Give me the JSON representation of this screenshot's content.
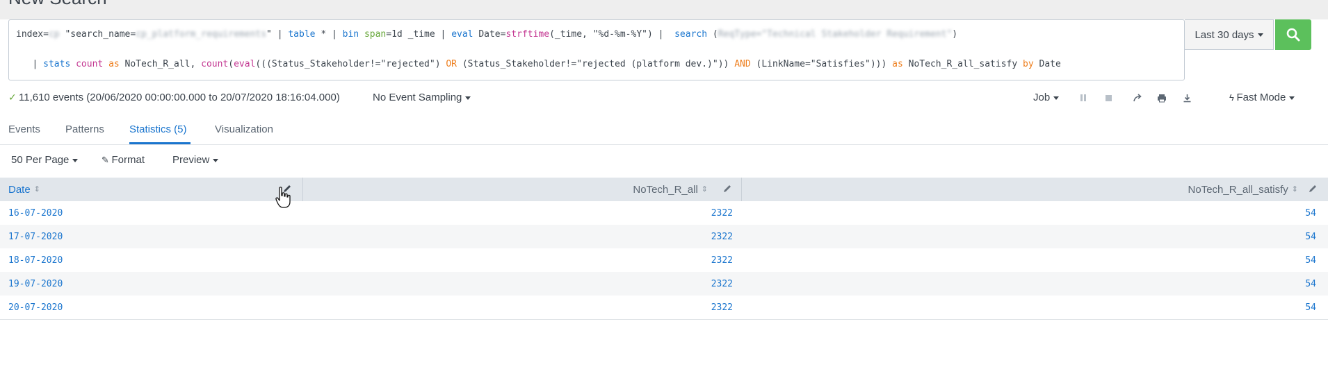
{
  "header": {
    "title": "New Search"
  },
  "search": {
    "line1": {
      "p1": "index=",
      "p1_blur": "cp",
      "p2": " \"search_name=",
      "p2_blur": "cp_platform_requirements",
      "p3": "\" | ",
      "table": "table",
      "p4": " * | ",
      "bin": "bin",
      "p5": " ",
      "span": "span",
      "p6": "=1d _time | ",
      "eval": "eval",
      "p7": " Date=",
      "strftime": "strftime",
      "p8": "(_time, \"%d-%m-%Y\") |  ",
      "search_kw": "search",
      "p9": " (",
      "p9_blur": "ReqType=\"Technical Stakeholder Requirement\"",
      "p10": ")"
    },
    "line2": {
      "p1": "   | ",
      "stats": "stats",
      "p2": " ",
      "count": "count",
      "p3": " ",
      "as1": "as",
      "p4": " NoTech_R_all, ",
      "count2": "count",
      "p5": "(",
      "eval2": "eval",
      "p6": "(((Status_Stakeholder!=\"rejected\") ",
      "or": "OR",
      "p7": " (Status_Stakeholder!=\"rejected (platform dev.)\")) ",
      "and": "AND",
      "p8": " (LinkName=\"Satisfies\"))) ",
      "as2": "as",
      "p9": " NoTech_R_all_satisfy ",
      "by": "by",
      "p10": " Date"
    }
  },
  "time_range": {
    "label": "Last 30 days"
  },
  "status": {
    "events": "11,610 events (20/06/2020 00:00:00.000 to 20/07/2020 18:16:04.000)",
    "sampling": "No Event Sampling",
    "job": "Job",
    "mode": "Fast Mode"
  },
  "tabs": [
    {
      "label": "Events"
    },
    {
      "label": "Patterns"
    },
    {
      "label": "Statistics (5)"
    },
    {
      "label": "Visualization"
    }
  ],
  "toolbar": {
    "per_page": "50 Per Page",
    "format": "Format",
    "preview": "Preview"
  },
  "table": {
    "columns": [
      "Date",
      "NoTech_R_all",
      "NoTech_R_all_satisfy"
    ],
    "rows": [
      [
        "16-07-2020",
        "2322",
        "54"
      ],
      [
        "17-07-2020",
        "2322",
        "54"
      ],
      [
        "18-07-2020",
        "2322",
        "54"
      ],
      [
        "19-07-2020",
        "2322",
        "54"
      ],
      [
        "20-07-2020",
        "2322",
        "54"
      ]
    ]
  },
  "colors": {
    "accent": "#1a75ce",
    "search_button": "#5cc05c",
    "keyword_orange": "#ee7e1d",
    "keyword_pink": "#c33691",
    "keyword_green": "#65a637"
  }
}
